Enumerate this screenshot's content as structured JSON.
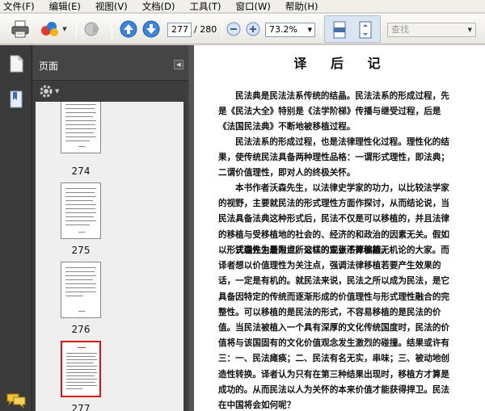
{
  "menu": [
    "文件(F)",
    "编辑(E)",
    "视图(V)",
    "文档(D)",
    "工具(T)",
    "窗口(W)",
    "帮助(H)"
  ],
  "toolbar": {
    "current_page": "277",
    "total_pages": "/ 280",
    "zoom": "73.2%",
    "search_placeholder": "查找"
  },
  "panel": {
    "title": "页面",
    "thumbnails": [
      {
        "label": "274",
        "selected": false
      },
      {
        "label": "275",
        "selected": false
      },
      {
        "label": "276",
        "selected": false
      },
      {
        "label": "277",
        "selected": true
      }
    ]
  },
  "document": {
    "title": "译 后 记",
    "paragraphs": [
      [
        "民法典是民法法系传统的结晶。民法法系的形成过程，先",
        "是《民法大全》特别是《法学阶梯》传播与继受过程，后是",
        "《法国民法典》不断地被移植过程。"
      ],
      [
        "民法法系的形成过程，也是法律理性化过程。理性化的结",
        "果，使传统民法具备两种理性品格：一谓形式理性，即法典；",
        "二谓价值理性，即对人的终极关怀。"
      ],
      [
        "本书作者沃森先生，以法律史学家的功力，以比较法学家",
        "的视野，主要就民法的形式理性方面作探讨，从而结论说，当",
        "民法具备法典这种形式后，民法不仅是可以移植的，并且法律",
        "的移植与受移植地的社会的、经济的和政治的因素无关。假如",
        "以形式理性为着眼点，这样的观点不算偏颇。"
      ],
      [
        "沃森先生是为世所公认的主张法律移植无机论的大家。而",
        "译者想以价值理性为关注点，强调法律移植若要产生效果的",
        "话，一定是有机的。就民法来说，民法之所以成为民法，是它",
        "具备因特定的传统而逐渐形成的价值理性与形式理性融合的完",
        "整性。可以移植的是民法的形式，不容易移植的是民法的价",
        "值。当民法被植入一个具有深厚的文化传统国度时，民法的价",
        "值将与该国固有的文化价值观念发生激烈的碰撞。结果或许有",
        "三：一、民法瘫痪；二、民法有名无实，串味；三、被动地创",
        "造性转换。译者认为只有在第三种结果出现时，移植方才算是",
        "成功的。从而民法以人为关怀的本来价值才能获得捍卫。民法",
        "在中国将会如何呢？"
      ]
    ]
  },
  "colors": {
    "selection_border": "#dd1111",
    "panel_bg": "#3d3d3d",
    "thumb_bg": "#efefef"
  }
}
